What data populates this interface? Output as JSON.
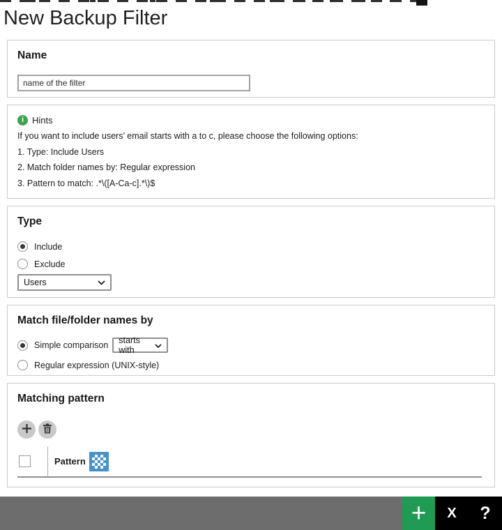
{
  "page": {
    "title": "New Backup Filter"
  },
  "sections": {
    "name": {
      "heading": "Name",
      "input_value": "name of the filter"
    },
    "hints": {
      "heading": "Hints",
      "lines": [
        "If you want to include users’ email starts with a to c, please choose the following options:",
        "1. Type: Include Users",
        "2. Match folder names by: Regular expression",
        "3. Pattern to match: .*\\([A-Ca-c].*\\)$"
      ]
    },
    "type": {
      "heading": "Type",
      "options": [
        {
          "label": "Include",
          "selected": true
        },
        {
          "label": "Exclude",
          "selected": false
        }
      ],
      "select_value": "Users"
    },
    "match": {
      "heading": "Match file/folder names by",
      "options": [
        {
          "label": "Simple comparison",
          "selected": true
        },
        {
          "label": "Regular expression (UNIX-style)",
          "selected": false
        }
      ],
      "comparison_value": "starts with"
    },
    "matching_pattern": {
      "heading": "Matching pattern",
      "column_header": "Pattern"
    }
  },
  "footer": {
    "add_label": "+",
    "close_label": "X",
    "help_label": "?"
  },
  "icons": {
    "hints": "info-icon",
    "type_select": "chevron-down-icon",
    "comparison_select": "chevron-down-icon",
    "toolbar_add": "plus-icon",
    "toolbar_delete": "trash-icon",
    "pattern_column": "checkered-pattern-icon"
  },
  "colors": {
    "info_green": "#3fa24c",
    "footer_green": "#1f9b53",
    "footer_gray": "#6d6d6d",
    "footer_black": "#000000",
    "pattern_blue": "#4793c9",
    "card_border": "#cbcbcb"
  }
}
